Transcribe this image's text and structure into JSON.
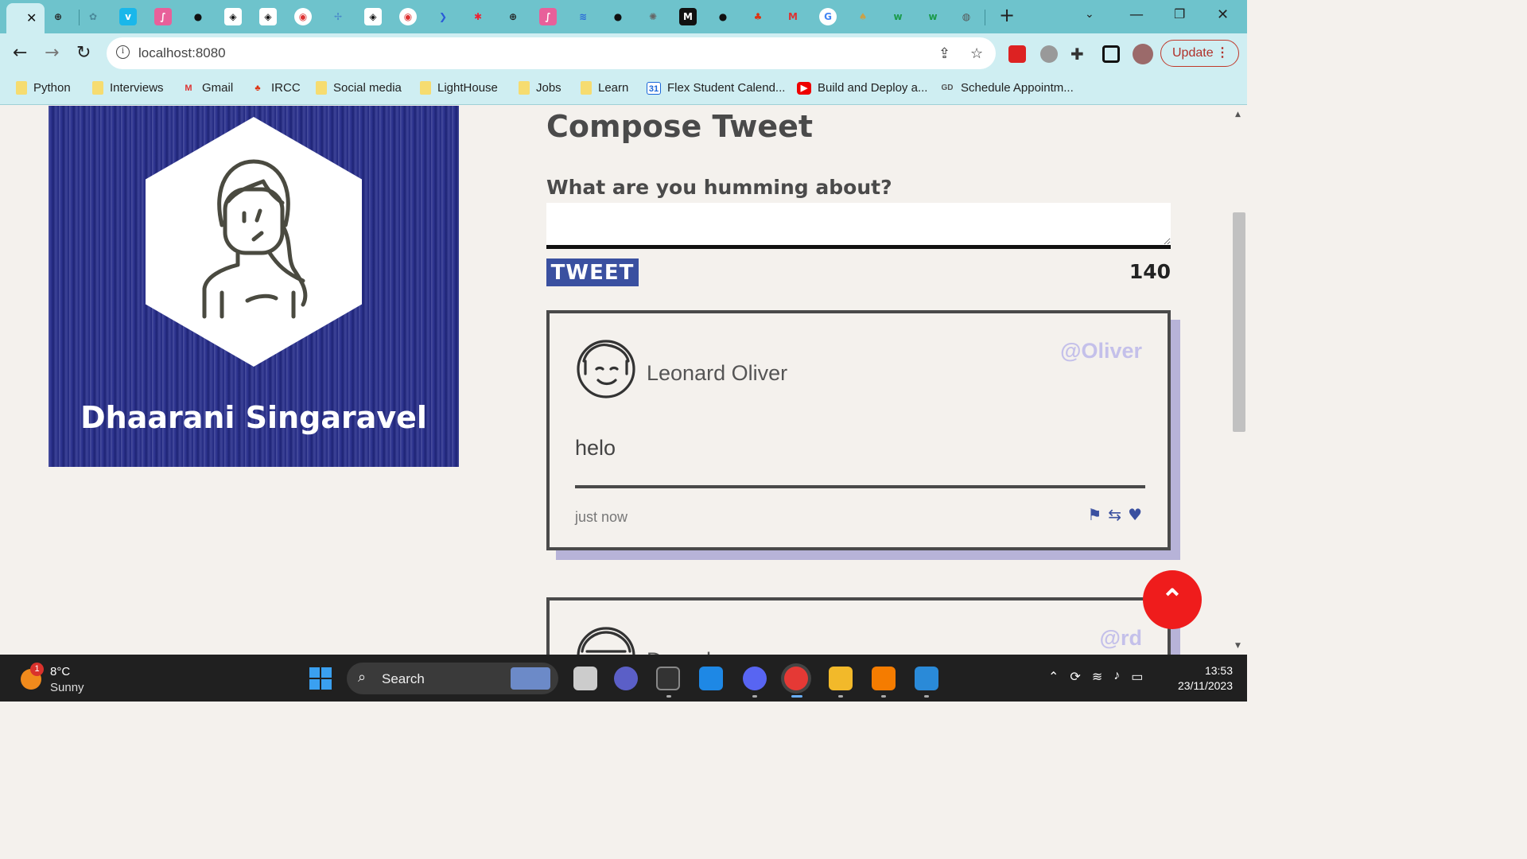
{
  "browser": {
    "url": "localhost:8080",
    "update_label": "Update",
    "bookmarks": [
      {
        "label": "Python",
        "icon": "folder-icon"
      },
      {
        "label": "Interviews",
        "icon": "folder-icon"
      },
      {
        "label": "Gmail",
        "icon": "gmail-icon"
      },
      {
        "label": "IRCC",
        "icon": "maple-leaf-icon"
      },
      {
        "label": "Social media",
        "icon": "folder-icon"
      },
      {
        "label": "LightHouse",
        "icon": "folder-icon"
      },
      {
        "label": "Jobs",
        "icon": "folder-icon"
      },
      {
        "label": "Learn",
        "icon": "folder-icon"
      },
      {
        "label": "Flex Student Calend...",
        "icon": "calendar-icon"
      },
      {
        "label": "Build and Deploy a...",
        "icon": "youtube-icon"
      },
      {
        "label": "Schedule Appointm...",
        "icon": "godaddy-icon"
      }
    ]
  },
  "profile": {
    "name": "Dhaarani Singaravel"
  },
  "compose": {
    "title": "Compose Tweet",
    "label": "What are you humming about?",
    "textarea_value": "",
    "button_label": "TWEET",
    "counter": "140"
  },
  "tweets": [
    {
      "name": "Leonard Oliver",
      "handle": "@Oliver",
      "text": "helo",
      "time": "just now"
    },
    {
      "name": "Damrd",
      "handle": "@rd"
    }
  ],
  "taskbar": {
    "temperature": "8°C",
    "condition": "Sunny",
    "weather_badge": "1",
    "search_label": "Search",
    "time": "13:53",
    "date": "23/11/2023"
  },
  "colors": {
    "accent": "#3a50a0",
    "handle": "#c4c0ea",
    "scroll_button": "#ef1c1c",
    "tab_strip": "#6ec3cc",
    "toolbar": "#cfeef2"
  }
}
